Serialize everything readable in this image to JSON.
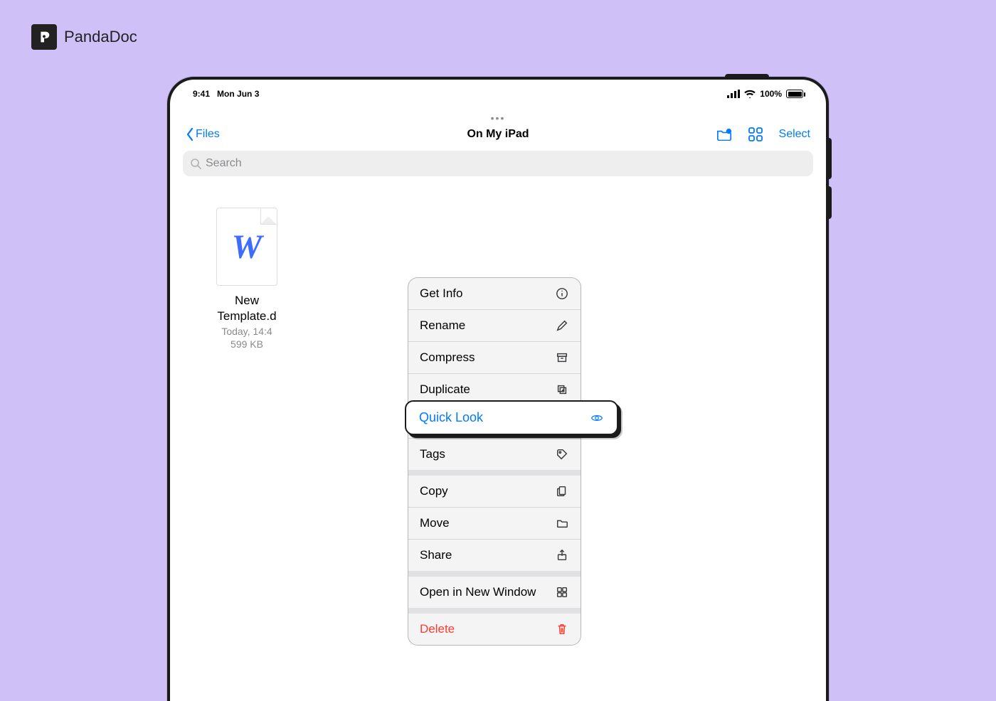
{
  "brand": {
    "name": "PandaDoc"
  },
  "status": {
    "time": "9:41",
    "date": "Mon Jun 3",
    "battery_text": "100%"
  },
  "nav": {
    "back_label": "Files",
    "title": "On My iPad",
    "select_label": "Select"
  },
  "search": {
    "placeholder": "Search"
  },
  "file": {
    "glyph": "W",
    "name_line1": "New",
    "name_line2": "Template.d",
    "meta_time": "Today, 14:4",
    "meta_size": "599 KB"
  },
  "menu": {
    "get_info": "Get Info",
    "rename": "Rename",
    "compress": "Compress",
    "duplicate": "Duplicate",
    "quick_look": "Quick Look",
    "tags": "Tags",
    "copy": "Copy",
    "move": "Move",
    "share": "Share",
    "open_new_window": "Open in New Window",
    "delete": "Delete"
  }
}
